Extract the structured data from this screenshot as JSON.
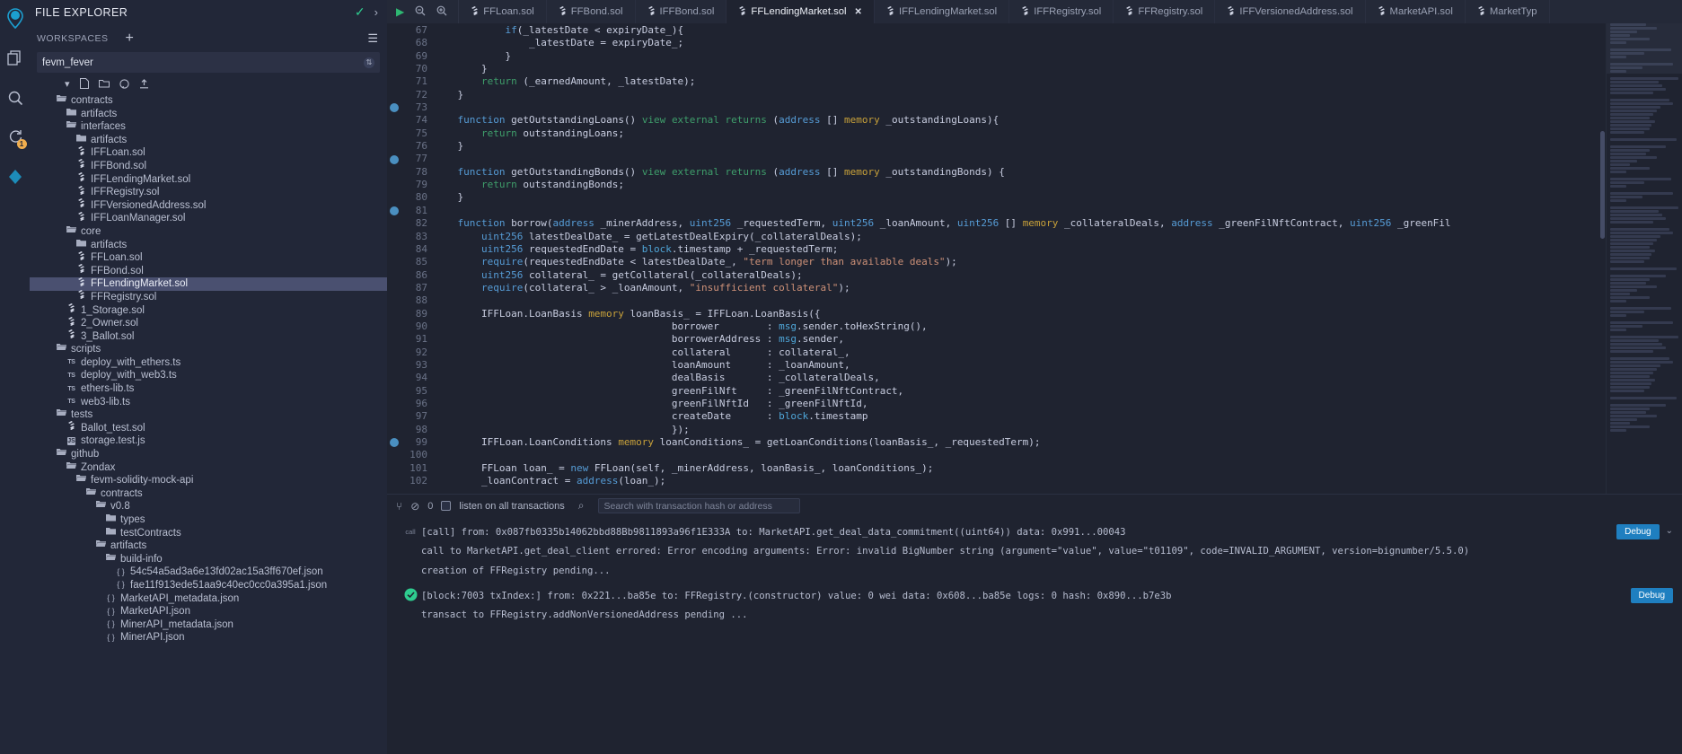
{
  "rail": {
    "items": [
      {
        "name": "home-icon",
        "glyph": "◉"
      },
      {
        "name": "file-explorer-icon",
        "glyph": "❏"
      },
      {
        "name": "search-icon",
        "glyph": "⌕"
      },
      {
        "name": "solidity-compiler-icon",
        "glyph": "⟳",
        "badge": "1"
      },
      {
        "name": "deploy-run-icon",
        "glyph": "⬨"
      }
    ]
  },
  "explorer": {
    "title": "FILE EXPLORER",
    "check_icon": "✓",
    "chevron_icon": "›",
    "workspaces_label": "WORKSPACES",
    "add_workspace_icon": "+",
    "menu_icon": "☰",
    "current_workspace": "fevm_fever",
    "toolbar_icons": [
      "▾",
      "🗋",
      "🗀",
      "⌾",
      "⬆"
    ],
    "tree": [
      {
        "indent": 1,
        "icon": "folder-open",
        "label": "contracts"
      },
      {
        "indent": 2,
        "icon": "folder",
        "label": "artifacts"
      },
      {
        "indent": 2,
        "icon": "folder-open",
        "label": "interfaces"
      },
      {
        "indent": 3,
        "icon": "folder",
        "label": "artifacts"
      },
      {
        "indent": 3,
        "icon": "sol",
        "label": "IFFLoan.sol"
      },
      {
        "indent": 3,
        "icon": "sol",
        "label": "IFFBond.sol"
      },
      {
        "indent": 3,
        "icon": "sol",
        "label": "IFFLendingMarket.sol"
      },
      {
        "indent": 3,
        "icon": "sol",
        "label": "IFFRegistry.sol"
      },
      {
        "indent": 3,
        "icon": "sol",
        "label": "IFFVersionedAddress.sol"
      },
      {
        "indent": 3,
        "icon": "sol",
        "label": "IFFLoanManager.sol"
      },
      {
        "indent": 2,
        "icon": "folder-open",
        "label": "core"
      },
      {
        "indent": 3,
        "icon": "folder",
        "label": "artifacts"
      },
      {
        "indent": 3,
        "icon": "sol",
        "label": "FFLoan.sol"
      },
      {
        "indent": 3,
        "icon": "sol",
        "label": "FFBond.sol"
      },
      {
        "indent": 3,
        "icon": "sol",
        "label": "FFLendingMarket.sol",
        "selected": true
      },
      {
        "indent": 3,
        "icon": "sol",
        "label": "FFRegistry.sol"
      },
      {
        "indent": 2,
        "icon": "sol",
        "label": "1_Storage.sol"
      },
      {
        "indent": 2,
        "icon": "sol",
        "label": "2_Owner.sol"
      },
      {
        "indent": 2,
        "icon": "sol",
        "label": "3_Ballot.sol"
      },
      {
        "indent": 1,
        "icon": "folder-open",
        "label": "scripts"
      },
      {
        "indent": 2,
        "icon": "ts",
        "label": "deploy_with_ethers.ts"
      },
      {
        "indent": 2,
        "icon": "ts",
        "label": "deploy_with_web3.ts"
      },
      {
        "indent": 2,
        "icon": "ts",
        "label": "ethers-lib.ts"
      },
      {
        "indent": 2,
        "icon": "ts",
        "label": "web3-lib.ts"
      },
      {
        "indent": 1,
        "icon": "folder-open",
        "label": "tests"
      },
      {
        "indent": 2,
        "icon": "sol",
        "label": "Ballot_test.sol"
      },
      {
        "indent": 2,
        "icon": "js",
        "label": "storage.test.js"
      },
      {
        "indent": 1,
        "icon": "folder-open",
        "label": "github"
      },
      {
        "indent": 2,
        "icon": "folder-open",
        "label": "Zondax"
      },
      {
        "indent": 3,
        "icon": "folder-open",
        "label": "fevm-solidity-mock-api"
      },
      {
        "indent": 4,
        "icon": "folder-open",
        "label": "contracts"
      },
      {
        "indent": 5,
        "icon": "folder-open",
        "label": "v0.8"
      },
      {
        "indent": 6,
        "icon": "folder",
        "label": "types"
      },
      {
        "indent": 6,
        "icon": "folder",
        "label": "testContracts"
      },
      {
        "indent": 5,
        "icon": "folder-open",
        "label": "artifacts"
      },
      {
        "indent": 6,
        "icon": "folder-open",
        "label": "build-info"
      },
      {
        "indent": 7,
        "icon": "json",
        "label": "54c54a5ad3a6e13fd02ac15a3ff670ef.json"
      },
      {
        "indent": 7,
        "icon": "json",
        "label": "fae11f913ede51aa9c40ec0cc0a395a1.json"
      },
      {
        "indent": 6,
        "icon": "json",
        "label": "MarketAPI_metadata.json"
      },
      {
        "indent": 6,
        "icon": "json",
        "label": "MarketAPI.json"
      },
      {
        "indent": 6,
        "icon": "json",
        "label": "MinerAPI_metadata.json"
      },
      {
        "indent": 6,
        "icon": "json",
        "label": "MinerAPI.json"
      }
    ]
  },
  "tabbar": {
    "left_icons": [
      {
        "name": "run-icon",
        "glyph": "▶",
        "accent": true
      },
      {
        "name": "zoom-out-icon",
        "glyph": "⊖"
      },
      {
        "name": "zoom-in-icon",
        "glyph": "⊕"
      }
    ],
    "tabs": [
      {
        "label": "FFLoan.sol",
        "active": false
      },
      {
        "label": "FFBond.sol",
        "active": false
      },
      {
        "label": "IFFBond.sol",
        "active": false
      },
      {
        "label": "FFLendingMarket.sol",
        "active": true,
        "close": "✕"
      },
      {
        "label": "IFFLendingMarket.sol",
        "active": false
      },
      {
        "label": "IFFRegistry.sol",
        "active": false
      },
      {
        "label": "FFRegistry.sol",
        "active": false
      },
      {
        "label": "IFFVersionedAddress.sol",
        "active": false
      },
      {
        "label": "MarketAPI.sol",
        "active": false
      },
      {
        "label": "MarketTyp",
        "active": false
      }
    ]
  },
  "editor": {
    "first_line": 67,
    "breakpoint_lines": [
      73,
      77,
      81,
      99
    ],
    "lines": [
      {
        "n": 67,
        "tokens": [
          {
            "t": "            ",
            "c": "pl"
          },
          {
            "t": "if",
            "c": "kw"
          },
          {
            "t": "(_latestDate ",
            "c": "pl"
          },
          {
            "t": "<",
            "c": "pl"
          },
          {
            "t": " expiryDate_){",
            "c": "pl"
          }
        ]
      },
      {
        "n": 68,
        "tokens": [
          {
            "t": "                _latestDate = expiryDate_;",
            "c": "pl"
          }
        ]
      },
      {
        "n": 69,
        "tokens": [
          {
            "t": "            }",
            "c": "pl"
          }
        ]
      },
      {
        "n": 70,
        "tokens": [
          {
            "t": "        }",
            "c": "pl"
          }
        ]
      },
      {
        "n": 71,
        "tokens": [
          {
            "t": "        ",
            "c": "pl"
          },
          {
            "t": "return",
            "c": "kw2"
          },
          {
            "t": " (_earnedAmount, _latestDate);",
            "c": "pl"
          }
        ]
      },
      {
        "n": 72,
        "tokens": [
          {
            "t": "    }",
            "c": "pl"
          }
        ]
      },
      {
        "n": 73,
        "tokens": []
      },
      {
        "n": 74,
        "tokens": [
          {
            "t": "    ",
            "c": "pl"
          },
          {
            "t": "function",
            "c": "kw"
          },
          {
            "t": " getOutstandingLoans() ",
            "c": "pl"
          },
          {
            "t": "view",
            "c": "kw2"
          },
          {
            "t": " ",
            "c": "pl"
          },
          {
            "t": "external",
            "c": "kw2"
          },
          {
            "t": " ",
            "c": "pl"
          },
          {
            "t": "returns",
            "c": "kw2"
          },
          {
            "t": " (",
            "c": "pl"
          },
          {
            "t": "address",
            "c": "addr"
          },
          {
            "t": " [] ",
            "c": "pl"
          },
          {
            "t": "memory",
            "c": "mem"
          },
          {
            "t": " _outstandingLoans){",
            "c": "pl"
          }
        ]
      },
      {
        "n": 75,
        "tokens": [
          {
            "t": "        ",
            "c": "pl"
          },
          {
            "t": "return",
            "c": "kw2"
          },
          {
            "t": " outstandingLoans;",
            "c": "pl"
          }
        ]
      },
      {
        "n": 76,
        "tokens": [
          {
            "t": "    }",
            "c": "pl"
          }
        ]
      },
      {
        "n": 77,
        "tokens": []
      },
      {
        "n": 78,
        "tokens": [
          {
            "t": "    ",
            "c": "pl"
          },
          {
            "t": "function",
            "c": "kw"
          },
          {
            "t": " getOutstandingBonds() ",
            "c": "pl"
          },
          {
            "t": "view",
            "c": "kw2"
          },
          {
            "t": " ",
            "c": "pl"
          },
          {
            "t": "external",
            "c": "kw2"
          },
          {
            "t": " ",
            "c": "pl"
          },
          {
            "t": "returns",
            "c": "kw2"
          },
          {
            "t": " (",
            "c": "pl"
          },
          {
            "t": "address",
            "c": "addr"
          },
          {
            "t": " [] ",
            "c": "pl"
          },
          {
            "t": "memory",
            "c": "mem"
          },
          {
            "t": " _outstandingBonds) {",
            "c": "pl"
          }
        ]
      },
      {
        "n": 79,
        "tokens": [
          {
            "t": "        ",
            "c": "pl"
          },
          {
            "t": "return",
            "c": "kw2"
          },
          {
            "t": " outstandingBonds;",
            "c": "pl"
          }
        ]
      },
      {
        "n": 80,
        "tokens": [
          {
            "t": "    }",
            "c": "pl"
          }
        ]
      },
      {
        "n": 81,
        "tokens": []
      },
      {
        "n": 82,
        "tokens": [
          {
            "t": "    ",
            "c": "pl"
          },
          {
            "t": "function",
            "c": "kw"
          },
          {
            "t": " borrow(",
            "c": "pl"
          },
          {
            "t": "address",
            "c": "addr"
          },
          {
            "t": " _minerAddress, ",
            "c": "pl"
          },
          {
            "t": "uint256",
            "c": "addr"
          },
          {
            "t": " _requestedTerm, ",
            "c": "pl"
          },
          {
            "t": "uint256",
            "c": "addr"
          },
          {
            "t": " _loanAmount, ",
            "c": "pl"
          },
          {
            "t": "uint256",
            "c": "addr"
          },
          {
            "t": " [] ",
            "c": "pl"
          },
          {
            "t": "memory",
            "c": "mem"
          },
          {
            "t": " _collateralDeals, ",
            "c": "pl"
          },
          {
            "t": "address",
            "c": "addr"
          },
          {
            "t": " _greenFilNftContract, ",
            "c": "pl"
          },
          {
            "t": "uint256",
            "c": "addr"
          },
          {
            "t": " _greenFil",
            "c": "pl"
          }
        ]
      },
      {
        "n": 83,
        "tokens": [
          {
            "t": "        ",
            "c": "pl"
          },
          {
            "t": "uint256",
            "c": "addr"
          },
          {
            "t": " latestDealDate_ = getLatestDealExpiry(_collateralDeals);",
            "c": "pl"
          }
        ]
      },
      {
        "n": 84,
        "tokens": [
          {
            "t": "        ",
            "c": "pl"
          },
          {
            "t": "uint256",
            "c": "addr"
          },
          {
            "t": " requestedEndDate = ",
            "c": "pl"
          },
          {
            "t": "block",
            "c": "blk"
          },
          {
            "t": ".timestamp + _requestedTerm;",
            "c": "pl"
          }
        ]
      },
      {
        "n": 85,
        "tokens": [
          {
            "t": "        ",
            "c": "pl"
          },
          {
            "t": "require",
            "c": "kw"
          },
          {
            "t": "(requestedEndDate < latestDealDate_, ",
            "c": "pl"
          },
          {
            "t": "\"term longer than available deals\"",
            "c": "str"
          },
          {
            "t": ");",
            "c": "pl"
          }
        ]
      },
      {
        "n": 86,
        "tokens": [
          {
            "t": "        ",
            "c": "pl"
          },
          {
            "t": "uint256",
            "c": "addr"
          },
          {
            "t": " collateral_ = getCollateral(_collateralDeals);",
            "c": "pl"
          }
        ]
      },
      {
        "n": 87,
        "tokens": [
          {
            "t": "        ",
            "c": "pl"
          },
          {
            "t": "require",
            "c": "kw"
          },
          {
            "t": "(collateral_ > _loanAmount, ",
            "c": "pl"
          },
          {
            "t": "\"insufficient collateral\"",
            "c": "str"
          },
          {
            "t": ");",
            "c": "pl"
          }
        ]
      },
      {
        "n": 88,
        "tokens": []
      },
      {
        "n": 89,
        "tokens": [
          {
            "t": "        IFFLoan.LoanBasis ",
            "c": "pl"
          },
          {
            "t": "memory",
            "c": "mem"
          },
          {
            "t": " loanBasis_ = IFFLoan.LoanBasis({",
            "c": "pl"
          }
        ]
      },
      {
        "n": 90,
        "tokens": [
          {
            "t": "                                        borrower        : ",
            "c": "pl"
          },
          {
            "t": "msg",
            "c": "blk"
          },
          {
            "t": ".sender.toHexString(),",
            "c": "pl"
          }
        ]
      },
      {
        "n": 91,
        "tokens": [
          {
            "t": "                                        borrowerAddress : ",
            "c": "pl"
          },
          {
            "t": "msg",
            "c": "blk"
          },
          {
            "t": ".sender,",
            "c": "pl"
          }
        ]
      },
      {
        "n": 92,
        "tokens": [
          {
            "t": "                                        collateral      : collateral_,",
            "c": "pl"
          }
        ]
      },
      {
        "n": 93,
        "tokens": [
          {
            "t": "                                        loanAmount      : _loanAmount,",
            "c": "pl"
          }
        ]
      },
      {
        "n": 94,
        "tokens": [
          {
            "t": "                                        dealBasis       : _collateralDeals,",
            "c": "pl"
          }
        ]
      },
      {
        "n": 95,
        "tokens": [
          {
            "t": "                                        greenFilNft     : _greenFilNftContract,",
            "c": "pl"
          }
        ]
      },
      {
        "n": 96,
        "tokens": [
          {
            "t": "                                        greenFilNftId   : _greenFilNftId,",
            "c": "pl"
          }
        ]
      },
      {
        "n": 97,
        "tokens": [
          {
            "t": "                                        createDate      : ",
            "c": "pl"
          },
          {
            "t": "block",
            "c": "blk"
          },
          {
            "t": ".timestamp",
            "c": "pl"
          }
        ]
      },
      {
        "n": 98,
        "tokens": [
          {
            "t": "                                        });",
            "c": "pl"
          }
        ]
      },
      {
        "n": 99,
        "tokens": [
          {
            "t": "        IFFLoan.LoanConditions ",
            "c": "pl"
          },
          {
            "t": "memory",
            "c": "mem"
          },
          {
            "t": " loanConditions_ = getLoanConditions(loanBasis_, _requestedTerm);",
            "c": "pl"
          }
        ]
      },
      {
        "n": 100,
        "tokens": []
      },
      {
        "n": 101,
        "tokens": [
          {
            "t": "        FFLoan loan_ = ",
            "c": "pl"
          },
          {
            "t": "new",
            "c": "kw"
          },
          {
            "t": " FFLoan(self, _minerAddress, loanBasis_, loanConditions_);",
            "c": "pl"
          }
        ]
      },
      {
        "n": 102,
        "tokens": [
          {
            "t": "        _loanContract = ",
            "c": "pl"
          },
          {
            "t": "address",
            "c": "addr"
          },
          {
            "t": "(loan_);",
            "c": "pl"
          }
        ]
      }
    ]
  },
  "terminal": {
    "toolbar": {
      "filter_icon": "⑂",
      "clear_icon": "⊘",
      "count": "0",
      "listen_label": "listen on all transactions",
      "search_icon": "⌕",
      "search_placeholder": "Search with transaction hash or address"
    },
    "entries": [
      {
        "icon": "call",
        "icon_kind": "call",
        "debug_label": "Debug",
        "caret": "⌄",
        "lines": [
          "[call] from: 0x087fb0335b14062bbd88Bb9811893a96f1E333A to: MarketAPI.get_deal_data_commitment((uint64)) data: 0x991...00043",
          "call to MarketAPI.get_deal_client errored: Error encoding arguments: Error: invalid BigNumber string (argument=\"value\", value=\"t01109\", code=INVALID_ARGUMENT, version=bignumber/5.5.0)",
          "creation of FFRegistry pending..."
        ]
      },
      {
        "icon": "✓",
        "icon_kind": "ok",
        "debug_label": "Debug",
        "caret": "",
        "lines": [
          "[block:7003 txIndex:] from: 0x221...ba85e to: FFRegistry.(constructor) value: 0 wei data: 0x608...ba85e logs: 0 hash: 0x890...b7e3b",
          "transact to FFRegistry.addNonVersionedAddress pending ..."
        ]
      }
    ]
  }
}
